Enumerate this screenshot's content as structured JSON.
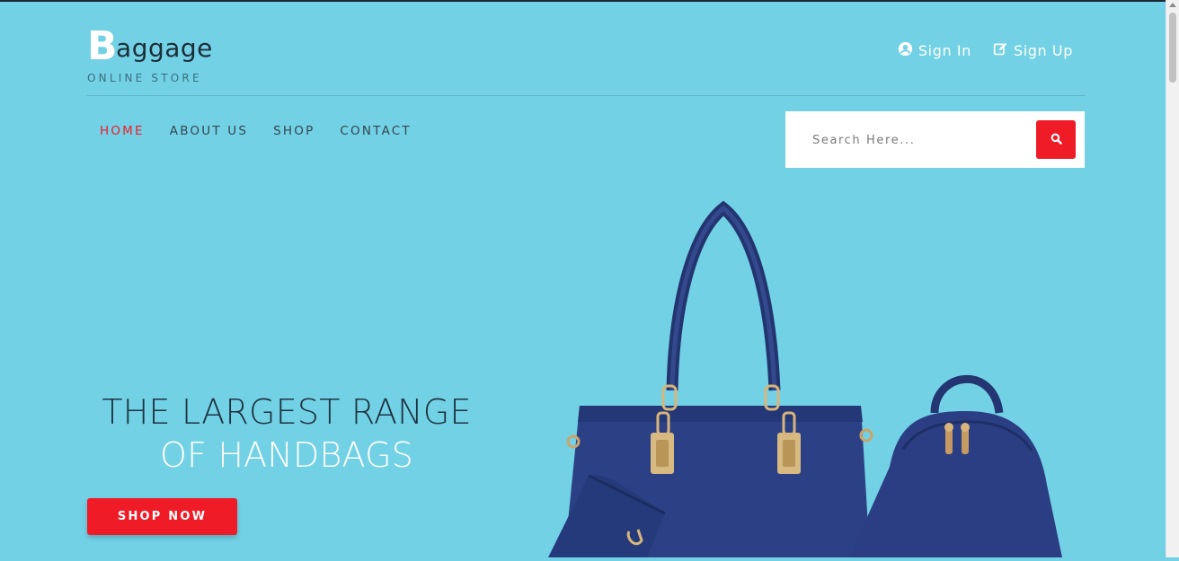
{
  "logo": {
    "first_letter": "B",
    "rest": "aggage",
    "tagline": "ONLINE STORE"
  },
  "auth": {
    "sign_in": "Sign In",
    "sign_up": "Sign Up"
  },
  "nav": {
    "items": [
      {
        "label": "HOME",
        "active": true
      },
      {
        "label": "ABOUT US",
        "active": false
      },
      {
        "label": "SHOP",
        "active": false
      },
      {
        "label": "CONTACT",
        "active": false
      }
    ]
  },
  "search": {
    "placeholder": "Search Here..."
  },
  "hero": {
    "line1": "THE LARGEST RANGE",
    "line2": "OF HANDBAGS",
    "cta": "SHOP NOW"
  },
  "colors": {
    "background": "#73d1e6",
    "accent": "#ef1c27",
    "bag": "#2a3e80"
  }
}
